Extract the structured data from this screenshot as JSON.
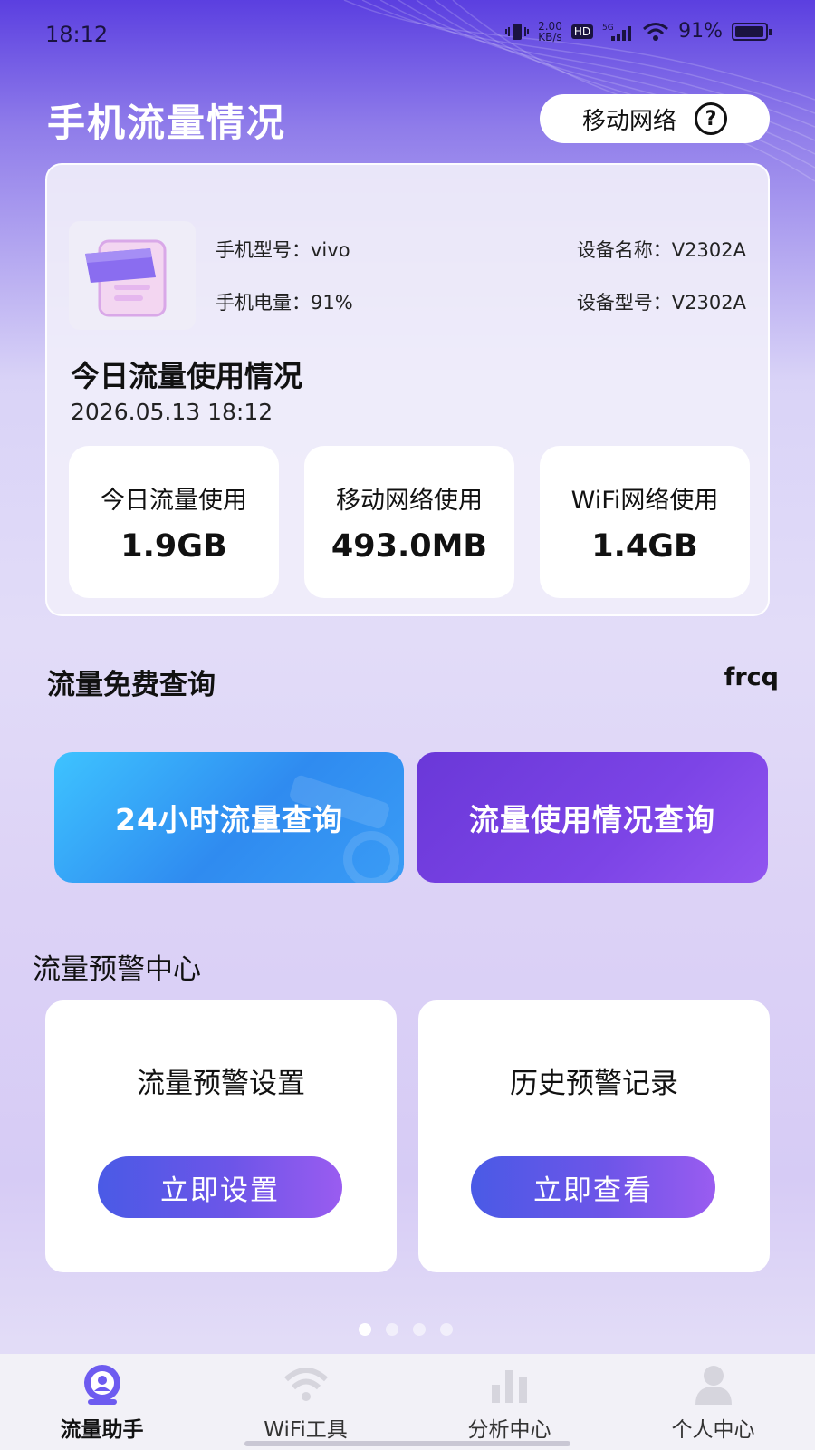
{
  "status_bar": {
    "time": "18:12",
    "speed_top": "2.00",
    "speed_unit": "KB/s",
    "hd": "HD",
    "network": "5G",
    "battery": "91%"
  },
  "header": {
    "title": "手机流量情况",
    "network_pill": "移动网络"
  },
  "device": {
    "model_label": "手机型号：vivo",
    "battery_label": "手机电量：91%",
    "name_label": "设备名称：V2302A",
    "type_label": "设备型号：V2302A"
  },
  "today": {
    "title": "今日流量使用情况",
    "datetime": "2026.05.13 18:12",
    "stats": [
      {
        "label": "今日流量使用",
        "value": "1.9GB"
      },
      {
        "label": "移动网络使用",
        "value": "493.0MB"
      },
      {
        "label": "WiFi网络使用",
        "value": "1.4GB"
      }
    ]
  },
  "query": {
    "title": "流量免费查询",
    "tag": "frcq",
    "btn_24h": "24小时流量查询",
    "btn_usage": "流量使用情况查询"
  },
  "warning": {
    "title": "流量预警中心",
    "cards": [
      {
        "title": "流量预警设置",
        "button": "立即设置"
      },
      {
        "title": "历史预警记录",
        "button": "立即查看"
      }
    ]
  },
  "tabs": [
    {
      "label": "流量助手",
      "icon": "traffic-assistant-icon"
    },
    {
      "label": "WiFi工具",
      "icon": "wifi-icon"
    },
    {
      "label": "分析中心",
      "icon": "bar-chart-icon"
    },
    {
      "label": "个人中心",
      "icon": "person-icon"
    }
  ],
  "colors": {
    "accent_purple": "#7c44e6",
    "accent_blue": "#2f8bf0"
  }
}
